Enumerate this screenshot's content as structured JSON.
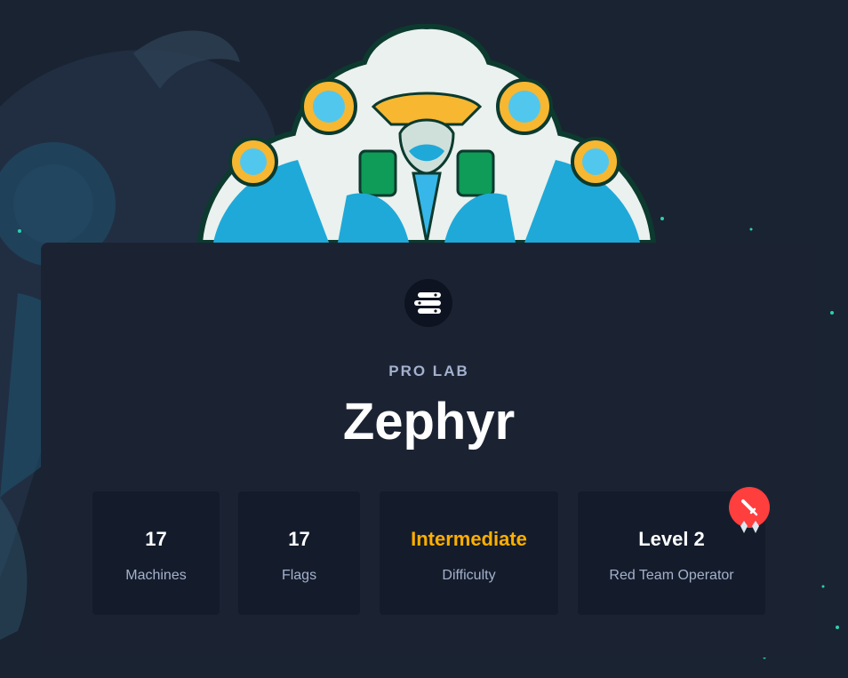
{
  "lab": {
    "category": "PRO LAB",
    "name": "Zephyr"
  },
  "stats": [
    {
      "value": "17",
      "label": "Machines"
    },
    {
      "value": "17",
      "label": "Flags"
    },
    {
      "value": "Intermediate",
      "label": "Difficulty"
    },
    {
      "value": "Level 2",
      "label": "Red Team Operator"
    }
  ],
  "icons": {
    "lab": "pro-lab-icon",
    "level_badge": "sword-icon",
    "level_gems": "gem-icon"
  },
  "colors": {
    "background": "#1a2332",
    "card": "#1b2333",
    "stat_box": "#141c2b",
    "accent_difficulty": "#ffaf00",
    "badge": "#ff3e3e",
    "muted_text": "#a4b1cd"
  }
}
